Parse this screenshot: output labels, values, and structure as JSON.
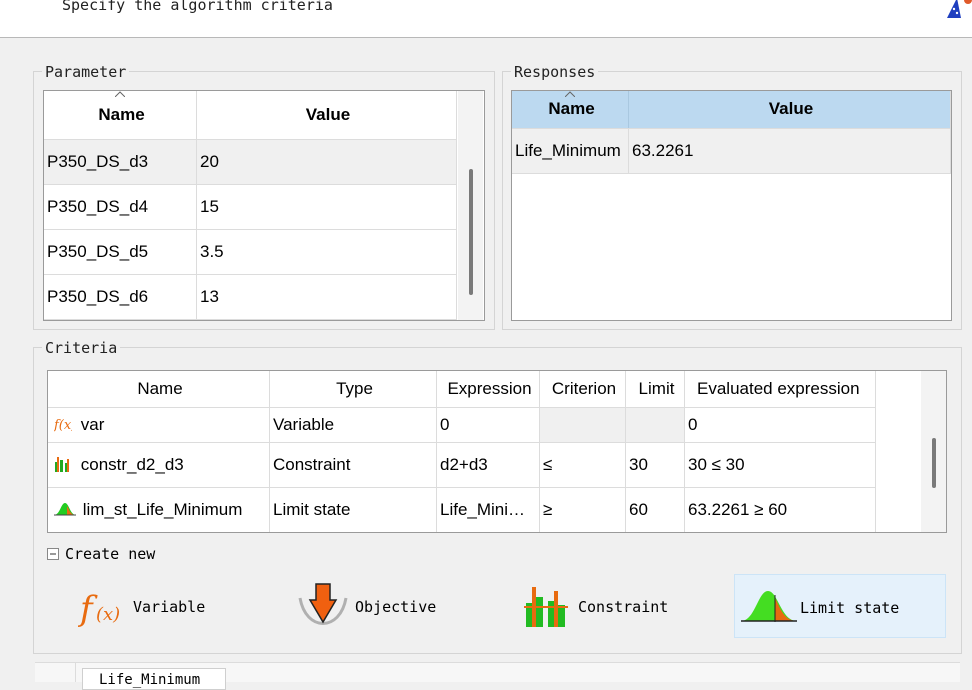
{
  "header": {
    "text": "Specify the algorithm criteria"
  },
  "parameter": {
    "title": "Parameter",
    "columns": [
      "Name",
      "Value"
    ],
    "rows": [
      {
        "name": "P350_DS_d3",
        "value": "20"
      },
      {
        "name": "P350_DS_d4",
        "value": "15"
      },
      {
        "name": "P350_DS_d5",
        "value": "3.5"
      },
      {
        "name": "P350_DS_d6",
        "value": "13"
      }
    ]
  },
  "responses": {
    "title": "Responses",
    "columns": [
      "Name",
      "Value"
    ],
    "rows": [
      {
        "name": "Life_Minimum",
        "value": "63.2261"
      }
    ]
  },
  "criteria": {
    "title": "Criteria",
    "columns": [
      "Name",
      "Type",
      "Expression",
      "Criterion",
      "Limit",
      "Evaluated expression"
    ],
    "rows": [
      {
        "icon": "function-icon",
        "name": "var",
        "type": "Variable",
        "expression": "0",
        "criterion": "",
        "limit": "",
        "evaluated": "0"
      },
      {
        "icon": "constraint-icon",
        "name": "constr_d2_d3",
        "type": "Constraint",
        "expression": "d2+d3",
        "criterion": "≤",
        "limit": "30",
        "evaluated": "30 ≤ 30"
      },
      {
        "icon": "limit-state-icon",
        "name": "lim_st_Life_Minimum",
        "type": "Limit state",
        "expression": "Life_Mini…",
        "criterion": "≥",
        "limit": "60",
        "evaluated": "63.2261 ≥ 60"
      }
    ]
  },
  "create_new": {
    "label": "Create new",
    "items": [
      {
        "icon": "function-icon",
        "label": "Variable"
      },
      {
        "icon": "objective-icon",
        "label": "Objective"
      },
      {
        "icon": "constraint-icon",
        "label": "Constraint"
      },
      {
        "icon": "limit-state-icon",
        "label": "Limit state"
      }
    ]
  },
  "bottom_tab": {
    "label": "Life_Minimum"
  },
  "colors": {
    "accent": "#bcd9f0",
    "selected_item": "#e5f1fb",
    "icon_orange": "#e86b10",
    "icon_green": "#22aa22"
  }
}
